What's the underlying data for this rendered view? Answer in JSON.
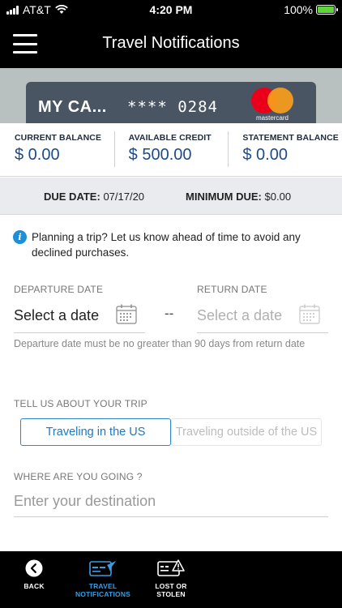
{
  "status_bar": {
    "carrier": "AT&T",
    "time": "4:20 PM",
    "battery": "100%"
  },
  "nav": {
    "title": "Travel Notifications"
  },
  "card": {
    "name": "MY CA...",
    "masked_number": "**** 0284",
    "brand": "mastercard"
  },
  "balances": [
    {
      "label": "CURRENT BALANCE",
      "value": "$ 0.00"
    },
    {
      "label": "AVAILABLE CREDIT",
      "value": "$ 500.00"
    },
    {
      "label": "STATEMENT BALANCE",
      "value": "$ 0.00"
    }
  ],
  "due": {
    "due_date_label": "DUE DATE:",
    "due_date_value": "07/17/20",
    "min_due_label": "MINIMUM DUE:",
    "min_due_value": "$0.00"
  },
  "info": {
    "text": "Planning a trip? Let us know ahead of time to avoid any declined purchases."
  },
  "dates": {
    "departure_label": "DEPARTURE DATE",
    "departure_value": "Select a date",
    "separator": "--",
    "return_label": "RETURN DATE",
    "return_value": "Select a date",
    "helper": "Departure date must be no greater than 90 days from return date"
  },
  "trip": {
    "label": "TELL US ABOUT YOUR TRIP",
    "options": [
      "Traveling in the US",
      "Traveling outside of the US"
    ],
    "selected": "Traveling in the US"
  },
  "destination": {
    "label": "WHERE ARE YOU GOING ?",
    "placeholder": "Enter your destination"
  },
  "bottom_nav": [
    {
      "label_line1": "BACK",
      "label_line2": "",
      "icon": "back-icon"
    },
    {
      "label_line1": "TRAVEL",
      "label_line2": "NOTIFICATIONS",
      "icon": "travel-card-icon",
      "active": true
    },
    {
      "label_line1": "LOST OR",
      "label_line2": "STOLEN",
      "icon": "lost-card-icon"
    }
  ],
  "colors": {
    "accent": "#1f78c1",
    "balance_text": "#1e4a87",
    "active_tab": "#3a9be0",
    "card": "#4a5563",
    "banner": "#b9c0c0"
  }
}
